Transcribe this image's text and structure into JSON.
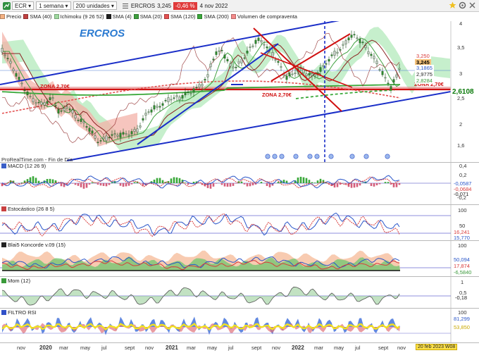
{
  "toolbar": {
    "symbol": "ECR",
    "timeframe": "1 semana",
    "units": "200 unidades",
    "instrument": "ERCROS",
    "price": "3,245",
    "change": "-0,46 %",
    "date": "4 nov 2022"
  },
  "legend": [
    {
      "label": "Precio",
      "color": "#f4b183"
    },
    {
      "label": "SMA (40)",
      "color": "#c04040"
    },
    {
      "label": "Ichimoku (9 26 52)",
      "color": "#9fd99f"
    },
    {
      "label": "SMA (4)",
      "color": "#202020"
    },
    {
      "label": "SMA (20)",
      "color": "#3fa03f"
    },
    {
      "label": "SMA (120)",
      "color": "#e35050"
    },
    {
      "label": "SMA (200)",
      "color": "#3aa83a"
    },
    {
      "label": "Volumen de compraventa",
      "color": "#f48a8a"
    }
  ],
  "main": {
    "title": "ERCROS",
    "source": "ProRealTime.com - Fin de Día",
    "zona_labels": [
      "ZONA 2,70€",
      "ZONA 2,70€",
      "ZONA 2,70€"
    ],
    "axis_ticks": [
      "4",
      "3,5",
      "3",
      "2,5",
      "2",
      "1,6"
    ],
    "price_labels": [
      {
        "text": "3,250",
        "color": "#d83a3a",
        "bg": "#ffffff"
      },
      {
        "text": "3,245",
        "color": "#000000",
        "bg": "#f5c27a"
      },
      {
        "text": "3,1865",
        "color": "#2a56c9",
        "bg": "#ffffff"
      },
      {
        "text": "2,9775",
        "color": "#222222",
        "bg": "#ffffff"
      },
      {
        "text": "2,8284",
        "color": "#3c9a3c",
        "bg": "#ffffff"
      },
      {
        "text": "2,6108",
        "color": "#0b7a0b",
        "bg": "#ffffff"
      }
    ]
  },
  "panels": {
    "macd": {
      "title": "MACD (12 26 9)",
      "ticks": [
        "0,4",
        "0,2",
        "-0,2"
      ],
      "labels": [
        "-0,0587",
        "-0,0684",
        "-0,071"
      ]
    },
    "stoch": {
      "title": "Estocástico (26 8 5)",
      "ticks": [
        "100",
        "50"
      ],
      "labels": [
        "16,241",
        "15,770"
      ]
    },
    "konc": {
      "title": "Blai5 Koncorde v.09 (15)",
      "ticks": [
        "100"
      ],
      "labels": [
        "50,094",
        "17,874",
        "-6,5840"
      ]
    },
    "mom": {
      "title": "Mom (12)",
      "ticks": [
        "1",
        "0,5"
      ],
      "labels": [
        "-0,18"
      ]
    },
    "rsi": {
      "title": "FILTRO RSI",
      "ticks": [
        "100"
      ],
      "labels": [
        "81,299",
        "53,850"
      ]
    }
  },
  "xaxis": {
    "labels": [
      "nov",
      "2020",
      "mar",
      "may",
      "jul",
      "sept",
      "nov",
      "2021",
      "mar",
      "may",
      "jul",
      "sept",
      "nov",
      "2022",
      "mar",
      "may",
      "jul",
      "sept",
      "nov"
    ],
    "years": [
      "2020",
      "2021",
      "2022"
    ],
    "date_tag": "20 feb 2023 W08"
  },
  "colors": {
    "trend_blue": "#1a2ec8",
    "zona_red": "#d01010",
    "ichimoku_cloud_green": "#a8e6b0",
    "ichimoku_cloud_red": "#f3b2a8"
  }
}
